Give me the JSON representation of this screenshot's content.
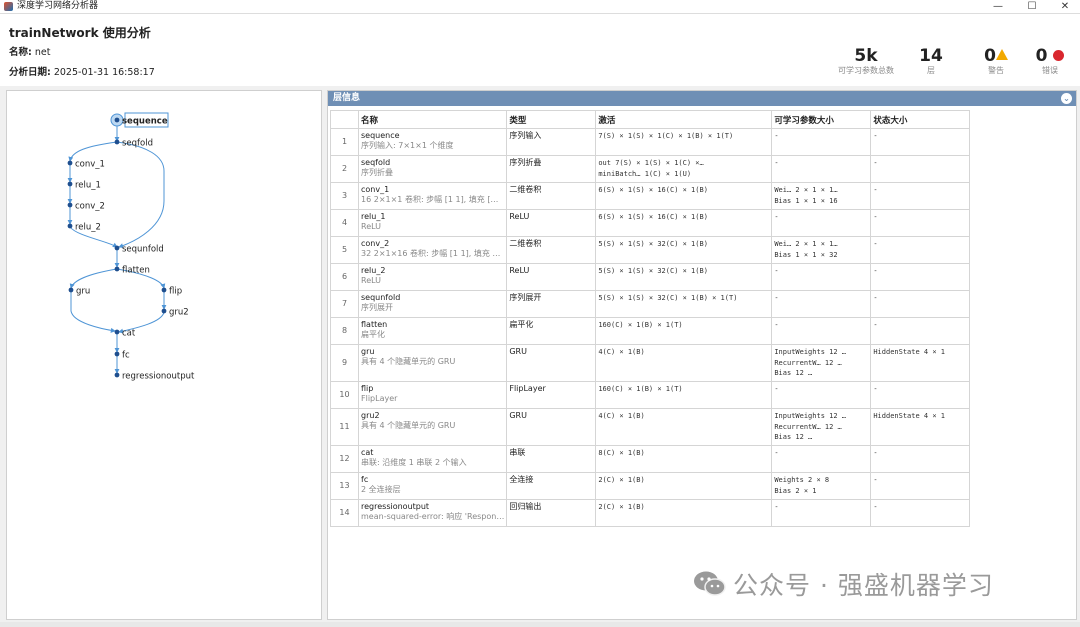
{
  "window": {
    "title": "深度学习网络分析器",
    "min": "—",
    "max": "☐",
    "close": "✕"
  },
  "header": {
    "title": "trainNetwork 使用分析",
    "name_label": "名称:",
    "name_value": "net",
    "date_label": "分析日期:",
    "date_value": "2025-01-31 16:58:17",
    "stats": [
      {
        "value": "5k",
        "label": "可学习参数总数"
      },
      {
        "value": "14",
        "label": "层"
      },
      {
        "value": "0",
        "label": "警告",
        "icon": "warning-icon"
      },
      {
        "value": "0",
        "label": "错误",
        "icon": "error-icon"
      }
    ]
  },
  "graph": {
    "nodes": [
      "sequence",
      "seqfold",
      "conv_1",
      "relu_1",
      "conv_2",
      "relu_2",
      "sequnfold",
      "flatten",
      "gru",
      "flip",
      "gru2",
      "cat",
      "fc",
      "regressionoutput"
    ],
    "selected": "sequence"
  },
  "table": {
    "panel_title": "层信息",
    "columns": [
      "名称",
      "类型",
      "激活",
      "可学习参数大小",
      "状态大小"
    ],
    "rows": [
      {
        "idx": "1",
        "name": "sequence",
        "desc": "序列输入: 7×1×1 个维度",
        "type": "序列输入",
        "act": [
          "7(S) × 1(S) × 1(C) × 1(B) × 1(T)"
        ],
        "params": [
          "-"
        ],
        "state": [
          "-"
        ]
      },
      {
        "idx": "2",
        "name": "seqfold",
        "desc": "序列折叠",
        "type": "序列折叠",
        "act": [
          "out        7(S) × 1(S) × 1(C) ×…",
          "miniBatch…  1(C) × 1(U)"
        ],
        "params": [
          "-"
        ],
        "state": [
          "-"
        ]
      },
      {
        "idx": "3",
        "name": "conv_1",
        "desc": "16 2×1×1 卷积: 步幅 [1 1], 填充 […",
        "type": "二维卷积",
        "act": [
          "6(S) × 1(S) × 16(C) × 1(B)"
        ],
        "params": [
          "Wei…  2 × 1 × 1…",
          "Bias   1 × 1 × 16"
        ],
        "state": [
          "-"
        ]
      },
      {
        "idx": "4",
        "name": "relu_1",
        "desc": "ReLU",
        "type": "ReLU",
        "act": [
          "6(S) × 1(S) × 16(C) × 1(B)"
        ],
        "params": [
          "-"
        ],
        "state": [
          "-"
        ]
      },
      {
        "idx": "5",
        "name": "conv_2",
        "desc": "32 2×1×16 卷积: 步幅 [1 1], 填充 …",
        "type": "二维卷积",
        "act": [
          "5(S) × 1(S) × 32(C) × 1(B)"
        ],
        "params": [
          "Wei…  2 × 1 × 1…",
          "Bias   1 × 1 × 32"
        ],
        "state": [
          "-"
        ]
      },
      {
        "idx": "6",
        "name": "relu_2",
        "desc": "ReLU",
        "type": "ReLU",
        "act": [
          "5(S) × 1(S) × 32(C) × 1(B)"
        ],
        "params": [
          "-"
        ],
        "state": [
          "-"
        ]
      },
      {
        "idx": "7",
        "name": "sequnfold",
        "desc": "序列展开",
        "type": "序列展开",
        "act": [
          "5(S) × 1(S) × 32(C) × 1(B) × 1(T)"
        ],
        "params": [
          "-"
        ],
        "state": [
          "-"
        ]
      },
      {
        "idx": "8",
        "name": "flatten",
        "desc": "扁平化",
        "type": "扁平化",
        "act": [
          "160(C) × 1(B) × 1(T)"
        ],
        "params": [
          "-"
        ],
        "state": [
          "-"
        ]
      },
      {
        "idx": "9",
        "name": "gru",
        "desc": "具有 4 个隐藏单元的 GRU",
        "type": "GRU",
        "act": [
          "4(C) × 1(B)"
        ],
        "params": [
          "InputWeights  12 …",
          "RecurrentW…   12 …",
          "Bias          12 …"
        ],
        "state": [
          "HiddenState  4 × 1"
        ]
      },
      {
        "idx": "10",
        "name": "flip",
        "desc": "FlipLayer",
        "type": "FlipLayer",
        "act": [
          "160(C) × 1(B) × 1(T)"
        ],
        "params": [
          "-"
        ],
        "state": [
          "-"
        ]
      },
      {
        "idx": "11",
        "name": "gru2",
        "desc": "具有 4 个隐藏单元的 GRU",
        "type": "GRU",
        "act": [
          "4(C) × 1(B)"
        ],
        "params": [
          "InputWeights  12 …",
          "RecurrentW…   12 …",
          "Bias          12 …"
        ],
        "state": [
          "HiddenState  4 × 1"
        ]
      },
      {
        "idx": "12",
        "name": "cat",
        "desc": "串联: 沿维度 1 串联 2 个输入",
        "type": "串联",
        "act": [
          "8(C) × 1(B)"
        ],
        "params": [
          "-"
        ],
        "state": [
          "-"
        ]
      },
      {
        "idx": "13",
        "name": "fc",
        "desc": "2 全连接层",
        "type": "全连接",
        "act": [
          "2(C) × 1(B)"
        ],
        "params": [
          "Weights  2 × 8",
          "Bias     2 × 1"
        ],
        "state": [
          "-"
        ]
      },
      {
        "idx": "14",
        "name": "regressionoutput",
        "desc": "mean-squared-error: 响应 'Respon…",
        "type": "回归输出",
        "act": [
          "2(C) × 1(B)"
        ],
        "params": [
          "-"
        ],
        "state": [
          "-"
        ]
      }
    ]
  },
  "watermark": "公众号 · 强盛机器学习",
  "colors": {
    "accent": "#6f8fb5",
    "edge": "#4f95d6",
    "node": "#1f4f8f",
    "warning": "#f2a900",
    "error": "#d9272e"
  }
}
